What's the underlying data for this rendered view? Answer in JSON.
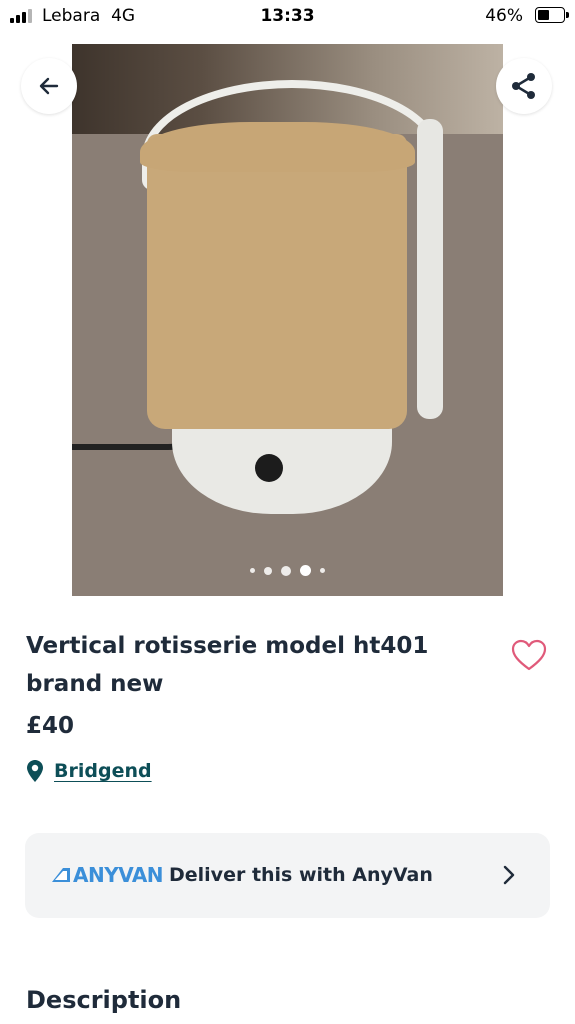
{
  "status_bar": {
    "carrier": "Lebara",
    "network": "4G",
    "time": "13:33",
    "battery_percent": "46%",
    "battery_level": 0.46
  },
  "gallery": {
    "image_count": 5,
    "active_index": 3,
    "back_icon": "arrow-left-icon",
    "share_icon": "share-icon"
  },
  "listing": {
    "title": "Vertical rotisserie model ht401 brand new",
    "price": "£40",
    "location": "Bridgend",
    "favorite_icon": "heart-outline-icon"
  },
  "delivery": {
    "brand": "ANYVAN",
    "label": "Deliver this with AnyVan",
    "brand_color": "#3b8fd9"
  },
  "sections": {
    "description_heading": "Description"
  },
  "colors": {
    "text": "#1f2b3a",
    "link": "#0d4e57",
    "favorite": "#e05a7a",
    "card_bg": "#f3f4f5"
  }
}
